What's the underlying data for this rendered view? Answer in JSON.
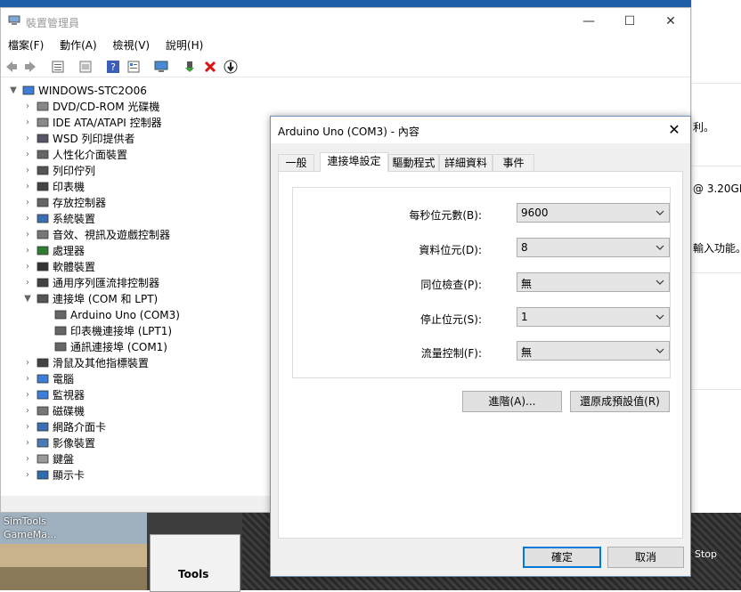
{
  "background": {
    "right_fragments": [
      "利。",
      "@ 3.20GH",
      "輸入功能。"
    ],
    "thumbnail_label_1": "SimTools",
    "thumbnail_label_2": "GameMa...",
    "tools_label": "Tools",
    "stop_label": "Stop"
  },
  "device_manager": {
    "title": "裝置管理員",
    "window_controls": [
      "—",
      "☐",
      "✕"
    ],
    "menu": [
      "檔案(F)",
      "動作(A)",
      "檢視(V)",
      "說明(H)"
    ],
    "toolbar_icons": [
      "back-icon",
      "forward-icon",
      "properties-view-icon",
      "list-icon",
      "help-icon",
      "details-icon",
      "scan-hardware-icon",
      "enable-device-icon",
      "uninstall-icon",
      "update-driver-icon"
    ],
    "root": "WINDOWS-STC2O06",
    "categories": [
      "DVD/CD-ROM 光碟機",
      "IDE ATA/ATAPI 控制器",
      "WSD 列印提供者",
      "人性化介面裝置",
      "列印佇列",
      "印表機",
      "存放控制器",
      "系統裝置",
      "音效、視訊及遊戲控制器",
      "處理器",
      "軟體裝置",
      "通用序列匯流排控制器",
      "連接埠 (COM 和 LPT)",
      "滑鼠及其他指標裝置",
      "電腦",
      "監視器",
      "磁碟機",
      "網路介面卡",
      "影像裝置",
      "鍵盤",
      "顯示卡"
    ],
    "expanded_children": [
      "Arduino Uno (COM3)",
      "印表機連接埠 (LPT1)",
      "通訊連接埠 (COM1)"
    ]
  },
  "dialog": {
    "title": "Arduino Uno (COM3) - 內容",
    "close": "✕",
    "tabs": [
      "一般",
      "連接埠設定",
      "驅動程式",
      "詳細資料",
      "事件"
    ],
    "active_tab": "連接埠設定",
    "fields": [
      {
        "label": "每秒位元數(B):",
        "value": "9600"
      },
      {
        "label": "資料位元(D):",
        "value": "8"
      },
      {
        "label": "同位檢查(P):",
        "value": "無"
      },
      {
        "label": "停止位元(S):",
        "value": "1"
      },
      {
        "label": "流量控制(F):",
        "value": "無"
      }
    ],
    "advanced_button": "進階(A)...",
    "restore_defaults_button": "還原成預設值(R)",
    "ok_button": "確定",
    "cancel_button": "取消"
  }
}
